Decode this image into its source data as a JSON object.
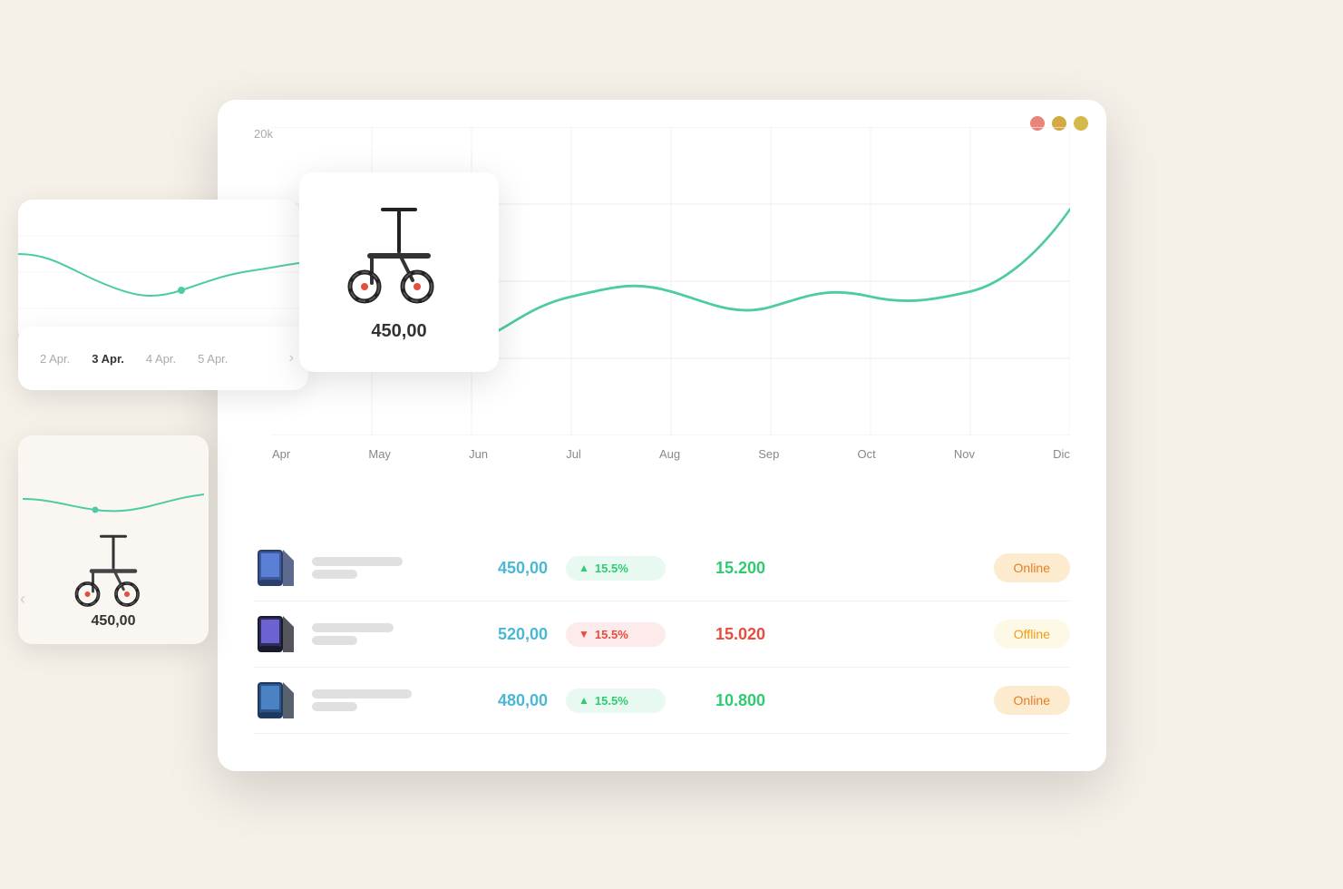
{
  "window": {
    "controls": {
      "dot1": "red",
      "dot2": "yellow",
      "dot3": "green"
    }
  },
  "chart": {
    "y_label": "20k",
    "x_labels": [
      "Apr",
      "May",
      "Jun",
      "Jul",
      "Aug",
      "Sep",
      "Oct",
      "Nov",
      "Dic"
    ]
  },
  "date_nav": {
    "dates": [
      "2 Apr.",
      "3 Apr.",
      "4 Apr.",
      "5 Apr."
    ],
    "active_index": 1
  },
  "product_hover": {
    "price": "450,00"
  },
  "small_card": {
    "price": "450,00"
  },
  "table": {
    "rows": [
      {
        "price": "450,00",
        "badge_direction": "up",
        "badge_pct": "15.5%",
        "sales": "15.200",
        "status": "Online",
        "status_type": "online"
      },
      {
        "price": "520,00",
        "badge_direction": "down",
        "badge_pct": "15.5%",
        "sales": "15.020",
        "status": "Offline",
        "status_type": "offline"
      },
      {
        "price": "480,00",
        "badge_direction": "up",
        "badge_pct": "15.5%",
        "sales": "10.800",
        "status": "Online",
        "status_type": "online"
      }
    ]
  }
}
